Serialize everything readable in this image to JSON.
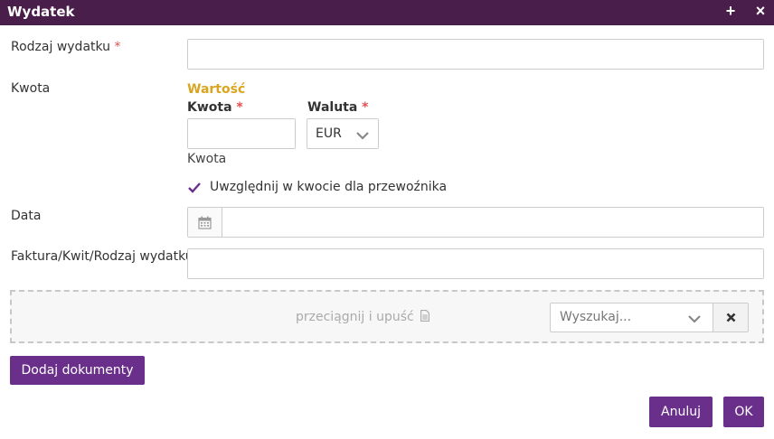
{
  "window": {
    "title": "Wydatek",
    "plus_label": "+",
    "close_label": "×"
  },
  "form": {
    "required_mark": "*",
    "rodzaj": {
      "label": "Rodzaj wydatku",
      "value": ""
    },
    "kwota_row": {
      "label": "Kwota",
      "section_title": "Wartość",
      "amount_label": "Kwota",
      "amount_value": "",
      "currency_label": "Waluta",
      "currency_value": "EUR",
      "help_text": "Kwota"
    },
    "checkbox": {
      "label": "Uwzględnij w kwocie dla przewoźnika",
      "checked": true
    },
    "data": {
      "label": "Data",
      "value": ""
    },
    "faktura": {
      "label": "Faktura/Kwit/Rodzaj wydatku",
      "value": ""
    }
  },
  "dropzone": {
    "text": "przeciągnij i upuść",
    "search_placeholder": "Wyszukaj..."
  },
  "buttons": {
    "add_documents": "Dodaj dokumenty",
    "cancel": "Anuluj",
    "ok": "OK"
  },
  "colors": {
    "titlebar": "#4a1e4a",
    "primary_button": "#6a2f8a",
    "section_title": "#d9a520",
    "required": "#e05050"
  }
}
